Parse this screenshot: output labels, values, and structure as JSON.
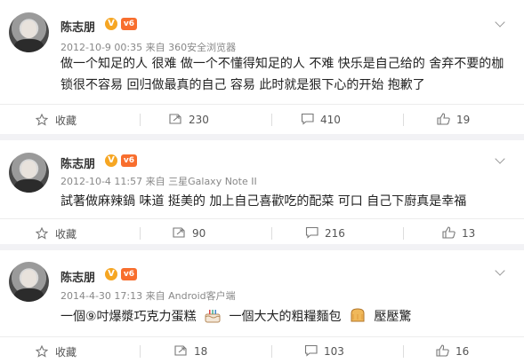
{
  "posts": [
    {
      "author": "陈志朋",
      "level_badge": "v6",
      "meta": "2012-10-9 00:35 来自 360安全浏览器",
      "content_lines": [
        "做一个知足的人 很难 做一个不懂得知足的人 不难 快乐是自己给的 舍弃不要的枷",
        "锁很不容易 回归做最真的自己 容易 此时就是狠下心的开始 抱歉了"
      ],
      "actions": {
        "favorite": "收藏",
        "share_count": "230",
        "comment_count": "410",
        "like_count": "19"
      }
    },
    {
      "author": "陈志朋",
      "level_badge": "v6",
      "meta": "2012-10-4 11:57 来自 三星Galaxy Note II",
      "content_lines": [
        "試著做麻辣鍋 味道 挺美的 加上自己喜歡吃的配菜 可口 自己下廚真是幸福"
      ],
      "actions": {
        "favorite": "收藏",
        "share_count": "90",
        "comment_count": "216",
        "like_count": "13"
      }
    },
    {
      "author": "陈志朋",
      "level_badge": "v6",
      "meta": "2014-4-30 17:13 来自 Android客户端",
      "content_parts": [
        "一個⑨吋爆漿巧克力蛋糕",
        "一個大大的粗糧麵包",
        "壓壓驚"
      ],
      "emoji": [
        "cake-icon",
        "bread-icon"
      ],
      "actions": {
        "favorite": "收藏",
        "share_count": "18",
        "comment_count": "103",
        "like_count": "16"
      }
    }
  ],
  "colors": {
    "verified": "#f6a623",
    "level": "#f86e2e",
    "text": "#222222",
    "meta": "#888888"
  }
}
